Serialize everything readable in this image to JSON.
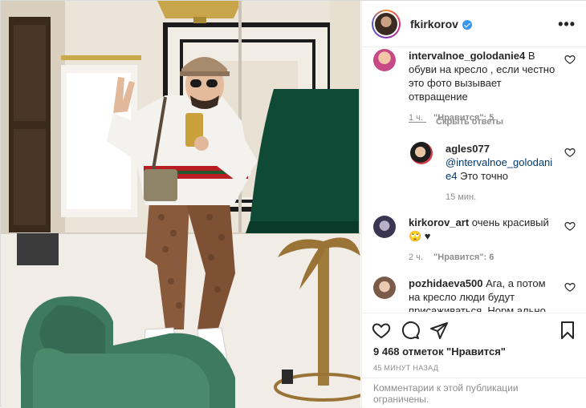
{
  "header": {
    "username": "fkirkorov",
    "more_label": "•••"
  },
  "comments": [
    {
      "username": "intervalnoe_golodanie4",
      "text": "В обуви на кресло , если честно это фото вызывает отвращение",
      "time": "1 ч.",
      "likes": "\"Нравится\": 5"
    },
    {
      "username": "agles077",
      "mention": "@intervalnoe_golodanie4",
      "text": "Это точно",
      "time": "15 мин."
    },
    {
      "username": "kirkorov_art",
      "text": "очень красивый 🙄 ♥",
      "time": "2 ч.",
      "likes": "\"Нравится\": 6"
    },
    {
      "username": "pozhidaeva500",
      "text": "Ага, а потом на кресло люди будут присаживаться. Норм ально"
    }
  ],
  "replies_toggle": "Скрыть ответы",
  "likes_text": "9 468 отметок \"Нравится\"",
  "posted_time": "45 МИНУТ НАЗАД",
  "comments_disabled": "Комментарии к этой публикации ограничены.",
  "colors": {
    "verified": "#3897f0",
    "secondary_text": "#8e8e8e",
    "mention": "#00376b",
    "chair_green": "#3e7a5e",
    "lamp_green": "#0f4a36"
  }
}
